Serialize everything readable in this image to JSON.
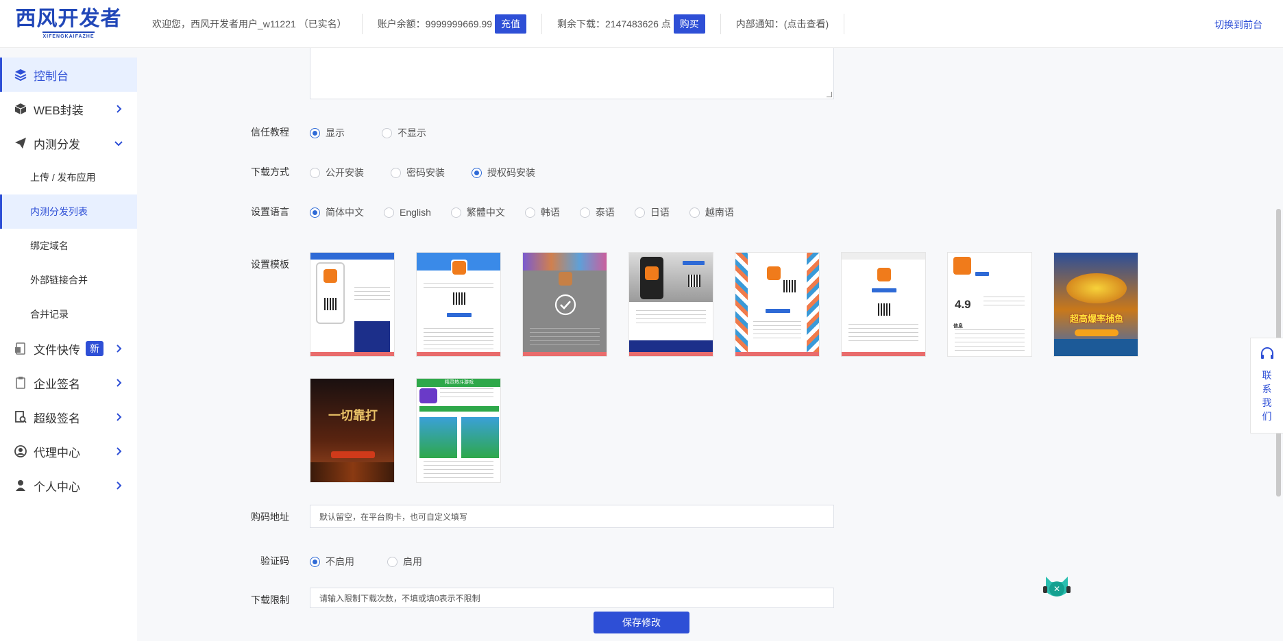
{
  "brand": {
    "title": "西风开发者",
    "subtitle": "XIFENGKAIFAZHE",
    "color": "#2147b8"
  },
  "topbar": {
    "welcome": "欢迎您，西风开发者用户_w11221 （已实名）",
    "balance_label": "账户余额：9999999669.99",
    "recharge_label": "充值",
    "downloads_label": "剩余下载：2147483626 点",
    "buy_label": "购买",
    "notice_label": "内部通知：(点击查看)",
    "switch_label": "切换到前台"
  },
  "sidebar": {
    "items": [
      {
        "label": "控制台",
        "icon": "layers-icon"
      },
      {
        "label": "WEB封装",
        "icon": "box-icon"
      },
      {
        "label": "内测分发",
        "icon": "paper-plane-icon"
      },
      {
        "label": "上传 / 发布应用"
      },
      {
        "label": "内测分发列表"
      },
      {
        "label": "绑定域名"
      },
      {
        "label": "外部链接合并"
      },
      {
        "label": "合并记录"
      },
      {
        "label": "文件快传",
        "icon": "file-icon",
        "badge": "新"
      },
      {
        "label": "企业签名",
        "icon": "clipboard-icon"
      },
      {
        "label": "超级签名",
        "icon": "doc-search-icon"
      },
      {
        "label": "代理中心",
        "icon": "agent-icon"
      },
      {
        "label": "个人中心",
        "icon": "user-icon"
      }
    ]
  },
  "form": {
    "trust": {
      "label": "信任教程",
      "options": [
        "显示",
        "不显示"
      ],
      "selected": 0
    },
    "download": {
      "label": "下载方式",
      "options": [
        "公开安装",
        "密码安装",
        "授权码安装"
      ],
      "selected": 2
    },
    "language": {
      "label": "设置语言",
      "options": [
        "简体中文",
        "English",
        "繁體中文",
        "韩语",
        "泰语",
        "日语",
        "越南语"
      ],
      "selected": 0
    },
    "template": {
      "label": "设置模板",
      "selected": 2,
      "t7_rating": "4.9",
      "t7_info": "信息",
      "t8_banner": "超高爆率捕鱼",
      "t9_banner": "一切靠打",
      "t10_header": "精灵热斗游戏"
    },
    "purchase": {
      "label": "购码地址",
      "placeholder": "默认留空，在平台购卡，也可自定义填写"
    },
    "captcha": {
      "label": "验证码",
      "options": [
        "不启用",
        "启用"
      ],
      "selected": 0
    },
    "limit": {
      "label": "下载限制",
      "placeholder": "请输入限制下载次数，不填或填0表示不限制"
    }
  },
  "save_label": "保存修改",
  "contact": {
    "label_1": "联",
    "label_2": "系",
    "label_3": "我",
    "label_4": "们"
  },
  "colors": {
    "accent": "#2e4fd6",
    "active_bg": "#e8f0ff",
    "radio": "#2e6ad6"
  }
}
